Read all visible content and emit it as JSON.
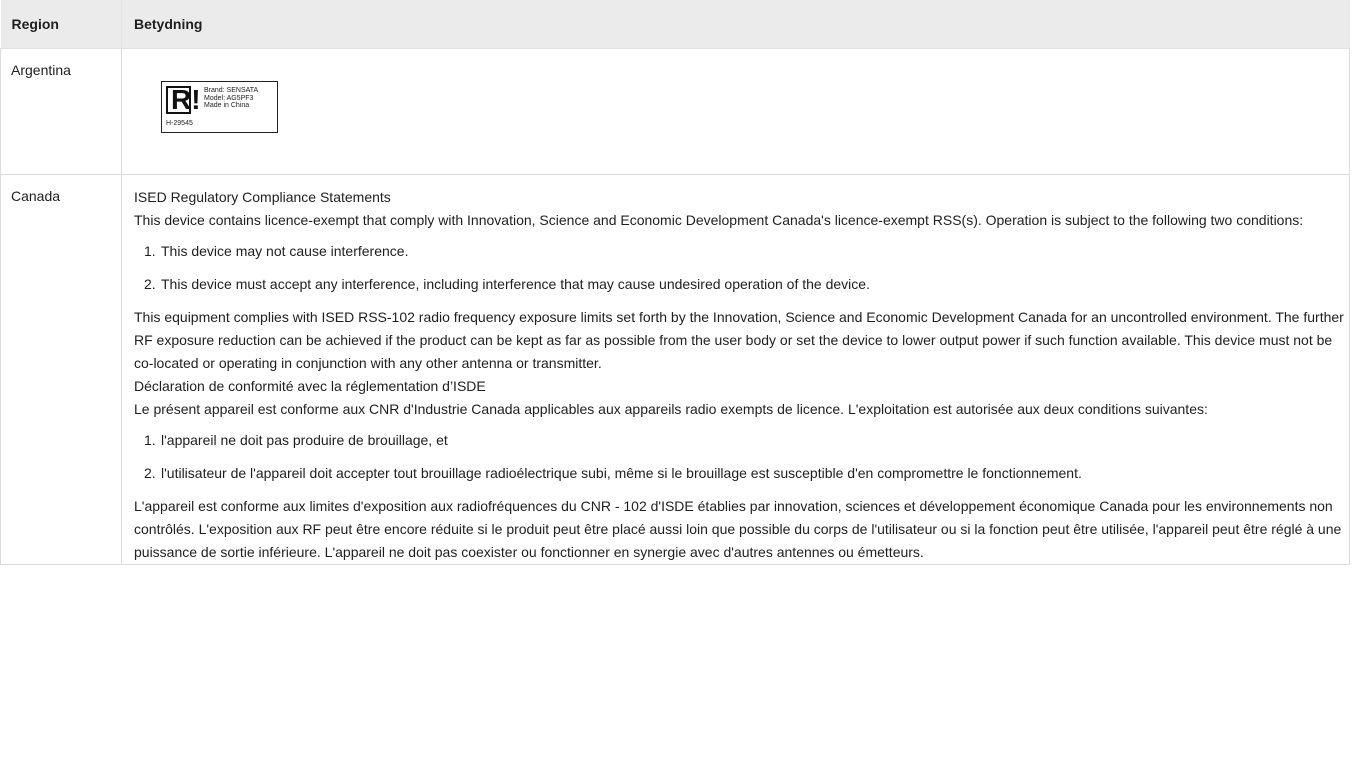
{
  "table": {
    "headers": {
      "region": "Region",
      "meaning": "Betydning"
    },
    "rows": [
      {
        "region": "Argentina",
        "label": {
          "logo": "R!",
          "lines": [
            "Brand: SENSATA",
            "Model: AG5PF3",
            "Made in China"
          ],
          "code": "H-29545"
        }
      },
      {
        "region": "Canada",
        "heading_en": "ISED Regulatory Compliance Statements",
        "para_en": "This device contains licence-exempt that comply with Innovation, Science and Economic Development Canada's licence-exempt RSS(s). Operation is subject to the following two conditions:",
        "list_en": [
          {
            "num": "1.",
            "text": "This device may not cause interference."
          },
          {
            "num": "2.",
            "text": "This device must accept any interference, including interference that may cause undesired operation of the device."
          }
        ],
        "rf_en": "This equipment complies with ISED RSS-102 radio frequency exposure limits set forth by the Innovation, Science and Economic Development Canada for an uncontrolled environment. The further RF exposure reduction can be achieved if the product can be kept as far as possible from the user body or set the device to lower output power if such function available. This device must not be co-located or operating in conjunction with any other antenna or transmitter.",
        "heading_fr": "Déclaration de conformité avec la réglementation d’ISDE",
        "para_fr": "Le présent appareil est conforme aux CNR d'Industrie Canada applicables aux appareils radio exempts de licence. L'exploitation est autorisée aux deux conditions suivantes:",
        "list_fr": [
          {
            "num": "1.",
            "text": "l'appareil ne doit pas produire de brouillage, et"
          },
          {
            "num": "2.",
            "text": "l'utilisateur de l'appareil doit accepter tout brouillage radioélectrique subi, même si le brouillage est susceptible d'en compromettre le fonctionnement."
          }
        ],
        "rf_fr": "L'appareil est conforme aux limites d'exposition aux radiofréquences du CNR - 102 d'ISDE établies par innovation, sciences et développement économique Canada pour les environnements non contrôlés. L'exposition aux RF peut être encore réduite si le produit peut être placé aussi loin que possible du corps de l'utilisateur ou si la fonction peut être utilisée, l'appareil peut être réglé à une puissance de sortie inférieure. L'appareil ne doit pas coexister ou fonctionner en synergie avec d'autres antennes ou émetteurs."
      }
    ]
  }
}
